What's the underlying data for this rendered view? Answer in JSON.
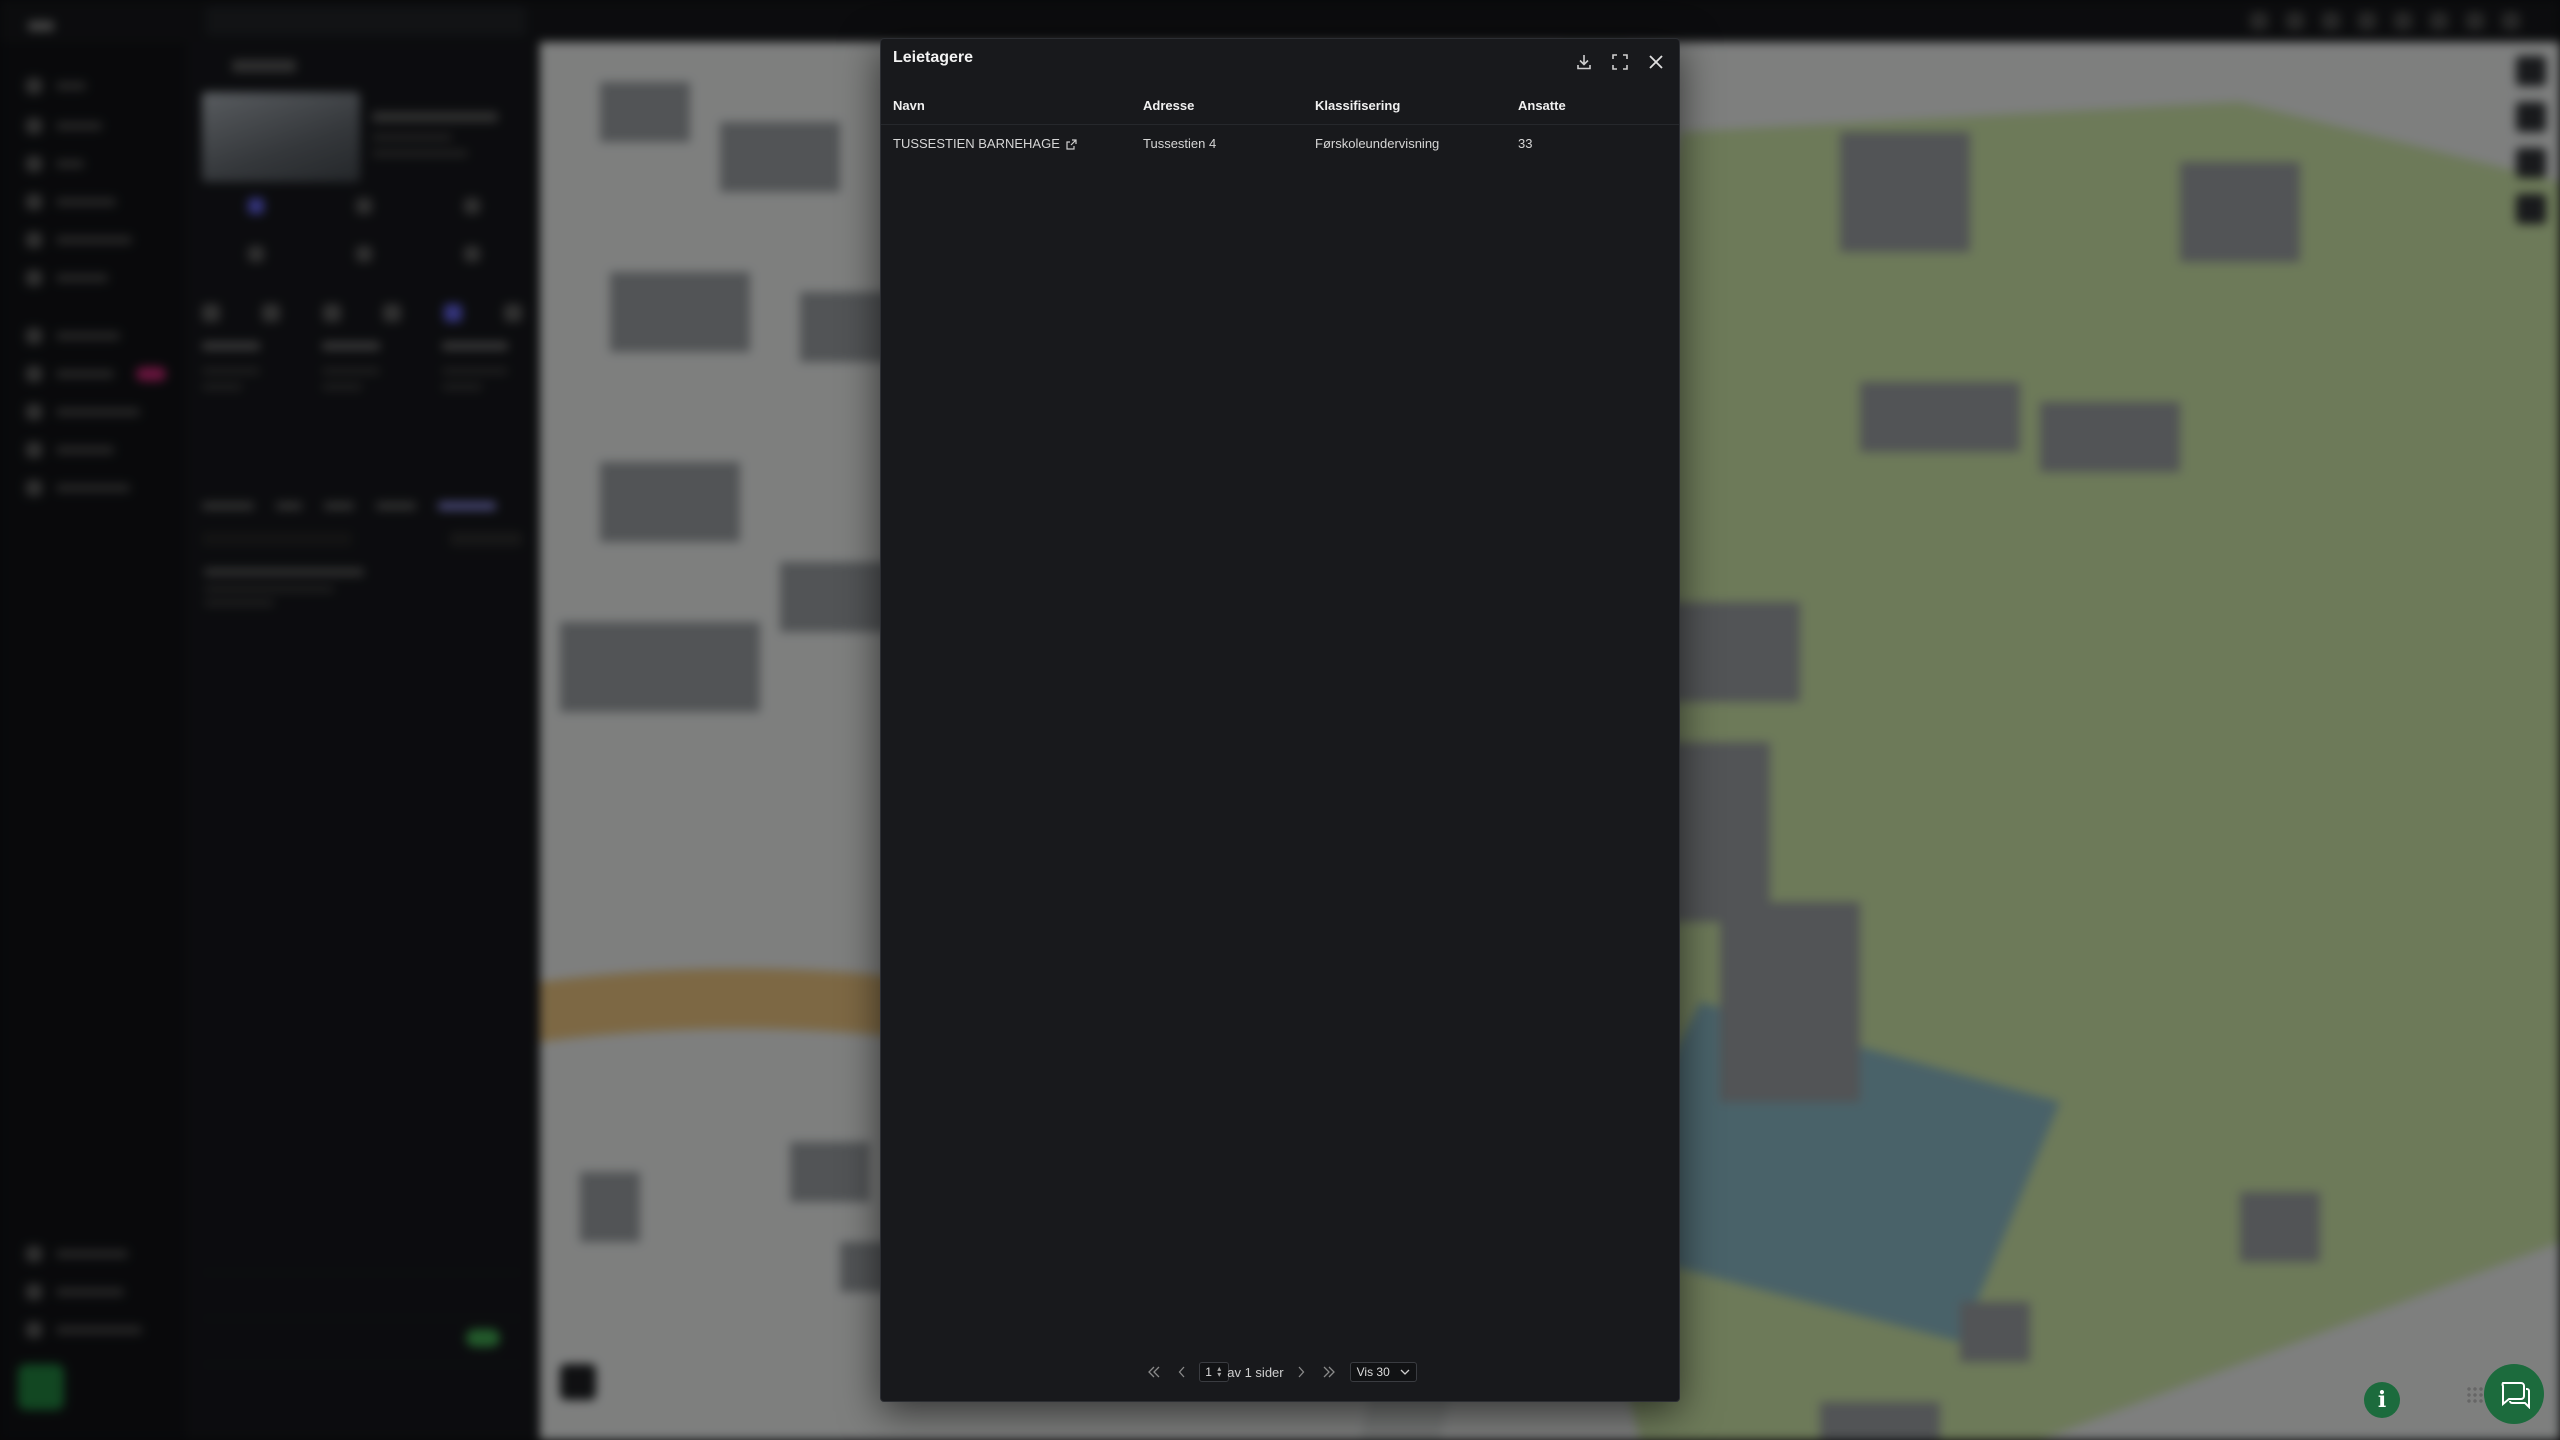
{
  "modal": {
    "title": "Leietagere",
    "columns": [
      "Navn",
      "Adresse",
      "Klassifisering",
      "Ansatte"
    ],
    "rows": [
      {
        "navn": "TUSSESTIEN BARNEHAGE",
        "adresse": "Tussestien 4",
        "klassifisering": "Førskoleundervisning",
        "ansatte": "33"
      }
    ],
    "pagination": {
      "current_page": "1",
      "of_pages_text": "av 1 sider",
      "page_size_label": "Vis 30"
    }
  },
  "icons": {
    "download": "download-icon",
    "fullscreen": "fullscreen-icon",
    "close": "close-icon",
    "external_link": "external-link-icon",
    "first": "first-page-icon",
    "prev": "previous-page-icon",
    "next": "next-page-icon",
    "last": "last-page-icon",
    "dropdown": "chevron-down-icon",
    "info": "info-icon",
    "chat": "chat-icon"
  },
  "colors": {
    "modal_bg": "#18191c",
    "overlay": "rgba(0,0,0,0.42)",
    "accent_green": "#1c6b3d"
  }
}
